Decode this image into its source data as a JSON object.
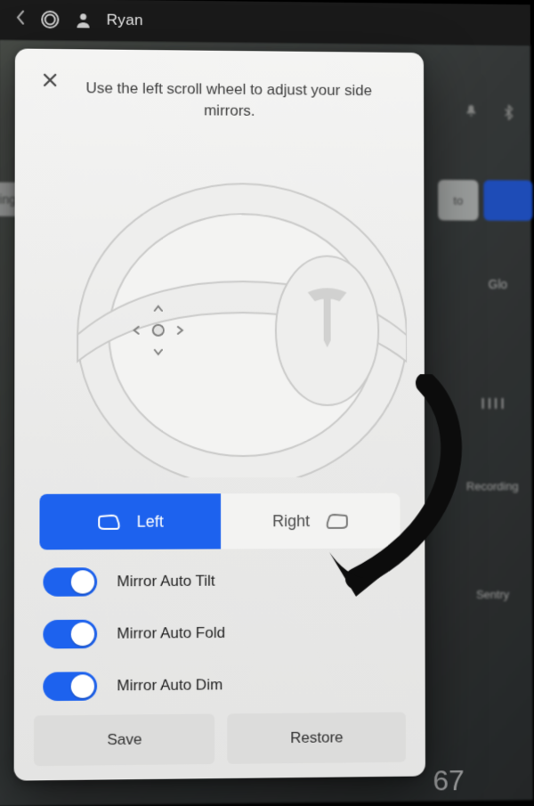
{
  "topbar": {
    "user_name": "Ryan"
  },
  "modal": {
    "instruction": "Use the left scroll wheel to adjust your side mirrors.",
    "selector": {
      "left_label": "Left",
      "right_label": "Right",
      "active": "left"
    },
    "toggles": [
      {
        "label": "Mirror Auto Tilt",
        "on": true
      },
      {
        "label": "Mirror Auto Fold",
        "on": true
      },
      {
        "label": "Mirror Auto Dim",
        "on": true
      }
    ],
    "buttons": {
      "save_label": "Save",
      "restore_label": "Restore"
    }
  },
  "background": {
    "sidebar_item_steering": "eering",
    "pill_auto": "to",
    "label_glo": "Glo",
    "label_recording": "Recording",
    "label_sentry": "Sentry",
    "temperature": "67"
  },
  "colors": {
    "accent": "#1d62ee"
  }
}
